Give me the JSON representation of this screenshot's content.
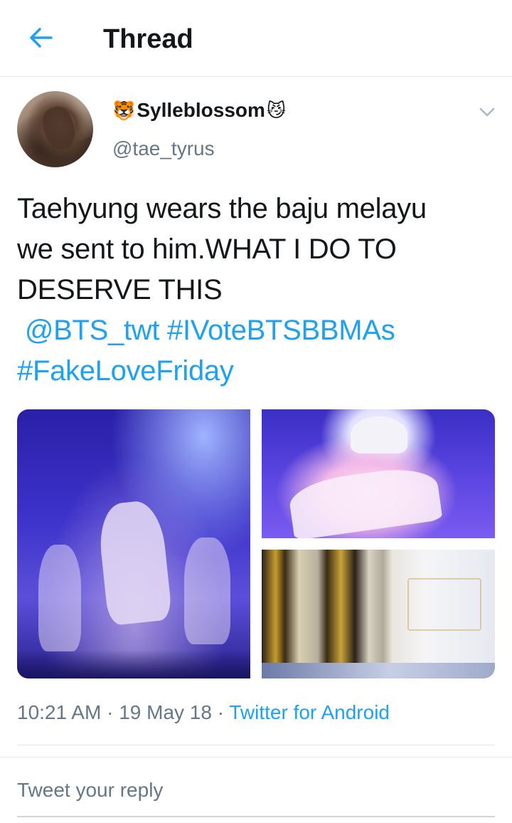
{
  "header": {
    "title": "Thread",
    "back_icon": "arrow-left-icon",
    "accent": "#1da1f2"
  },
  "tweet": {
    "author": {
      "display_name": "Sylleblossom",
      "badge_left": "🐯",
      "badge_right": "😼",
      "handle": "@tae_tyrus"
    },
    "text_lines": [
      "Taehyung wears the baju melayu",
      "we sent to him.WHAT I DO TO",
      "DESERVE THIS"
    ],
    "mention": "@BTS_twt",
    "hashtag_1": "#IVoteBTSBBMAs",
    "hashtag_2": "#FakeLoveFriday",
    "media_count": 3,
    "time": "10:21 AM",
    "separator": "·",
    "date": "19 May 18",
    "source": "Twitter for Android"
  },
  "reply": {
    "placeholder": "Tweet your reply"
  },
  "colors": {
    "text": "#14171a",
    "secondary": "#657786",
    "link": "#1da1f2",
    "divider": "#e1e8ed"
  }
}
